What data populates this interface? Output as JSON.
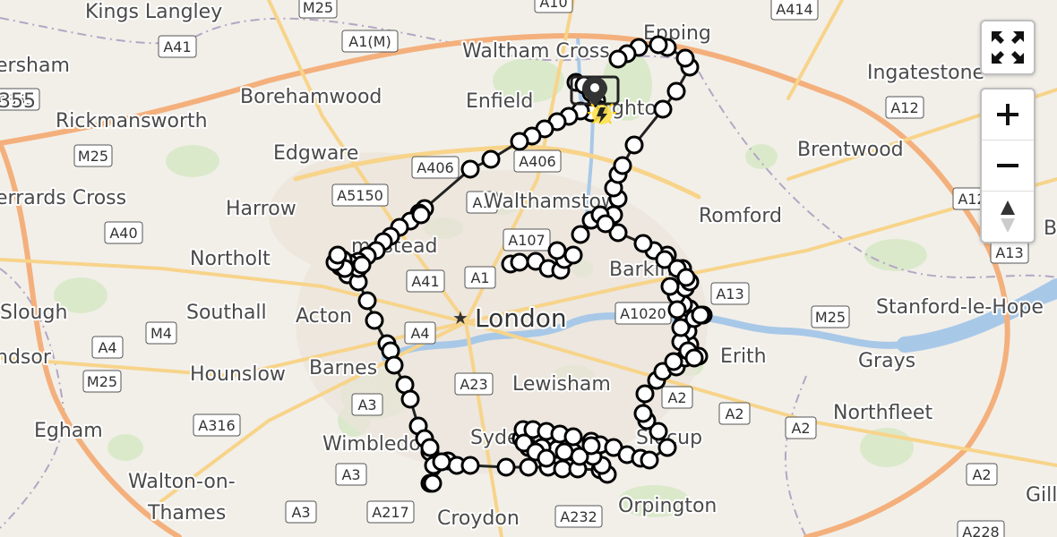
{
  "map": {
    "towns": [
      {
        "label": "Kings Langley"
      },
      {
        "label": "ersham"
      },
      {
        "label": "355"
      },
      {
        "label": "Rickmansworth"
      },
      {
        "label": "Borehamwood"
      },
      {
        "label": "Waltham Cross"
      },
      {
        "label": "Epping"
      },
      {
        "label": "Enfield"
      },
      {
        "label": "ghton"
      },
      {
        "label": "Edgware"
      },
      {
        "label": "Ingatestone"
      },
      {
        "label": "Brentwood"
      },
      {
        "label": "errards Cross"
      },
      {
        "label": "Harrow"
      },
      {
        "label": "Walthamstow"
      },
      {
        "label": "Romford"
      },
      {
        "label": "Northolt"
      },
      {
        "label": "mpstead"
      },
      {
        "label": "Barking"
      },
      {
        "label": "Slough"
      },
      {
        "label": "Southall"
      },
      {
        "label": "Acton"
      },
      {
        "label": "Stanford-le-Hope"
      },
      {
        "label": "ndsor"
      },
      {
        "label": "Hounslow"
      },
      {
        "label": "Barnes"
      },
      {
        "label": "Erith"
      },
      {
        "label": "Grays"
      },
      {
        "label": "Lewisham"
      },
      {
        "label": "Egham"
      },
      {
        "label": "Northfleet"
      },
      {
        "label": "Wimbledon"
      },
      {
        "label": "Sydenham"
      },
      {
        "label": "Sidcup"
      },
      {
        "label": "Walton-on-"
      },
      {
        "label": "Thames"
      },
      {
        "label": "Croydon"
      },
      {
        "label": "Orpington"
      },
      {
        "label": "Gill"
      },
      {
        "label": "B"
      }
    ],
    "city": "London",
    "roads": [
      "M25",
      "A10",
      "A414",
      "A41",
      "A1(M)",
      "A12",
      "A355",
      "M25",
      "A406",
      "A406",
      "A1",
      "A5150",
      "A12",
      "A40",
      "A107",
      "A1",
      "A13",
      "A41",
      "M25",
      "A1020",
      "M4",
      "A4",
      "A4",
      "A2",
      "A3",
      "A23",
      "A2",
      "A2",
      "M25",
      "A316",
      "A3",
      "A217",
      "A232",
      "A2",
      "A228",
      "A13",
      "A3"
    ],
    "track_color": "#222222",
    "marker_fill": "#ffffff",
    "marker_stroke": "#000000",
    "icons": [
      "start-map-pin-icon",
      "incident-flash-icon"
    ]
  },
  "controls": {
    "fullscreen_icon": "fullscreen-arrows-icon",
    "zoom_in_label": "+",
    "zoom_out_label": "−",
    "compass_icon": "compass-north-icon"
  }
}
